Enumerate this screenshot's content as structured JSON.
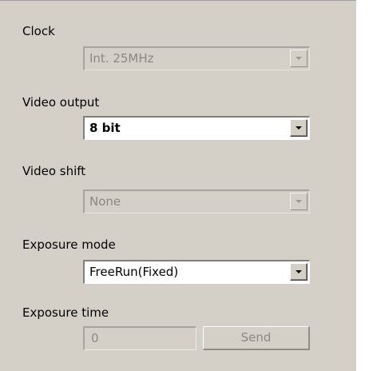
{
  "clock": {
    "label": "Clock",
    "selected": "Int. 25MHz",
    "enabled": false
  },
  "video_output": {
    "label": "Video output",
    "selected": "8 bit",
    "enabled": true
  },
  "video_shift": {
    "label": "Video shift",
    "selected": "None",
    "enabled": false
  },
  "exposure_mode": {
    "label": "Exposure mode",
    "selected": "FreeRun(Fixed)",
    "enabled": true
  },
  "exposure_time": {
    "label": "Exposure time",
    "value": "0",
    "enabled": false,
    "send_label": "Send"
  },
  "icons": {
    "dropdown_arrow": "chevron-down-icon"
  },
  "colors": {
    "panel_bg": "#d4d0c8",
    "disabled_text": "#8a8881"
  }
}
